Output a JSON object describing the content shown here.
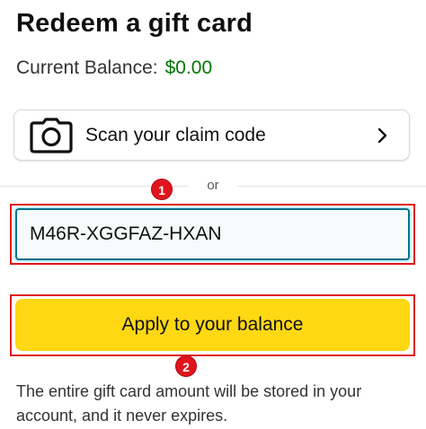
{
  "page": {
    "title": "Redeem a gift card"
  },
  "balance": {
    "label": "Current Balance:",
    "amount": "$0.00",
    "amount_color": "#007600"
  },
  "scan": {
    "label": "Scan your claim code",
    "icon": "camera-icon",
    "chevron_icon": "chevron-right-icon"
  },
  "divider": {
    "text": "or"
  },
  "claim_code": {
    "value": "M46R-XGGFAZ-HXAN",
    "placeholder": ""
  },
  "apply_button": {
    "label": "Apply to your balance",
    "color": "#ffd814"
  },
  "info": {
    "text": "The entire gift card amount will be stored in your account, and it never expires."
  },
  "annotations": {
    "step1": "1",
    "step2": "2",
    "color": "#e0141e"
  }
}
